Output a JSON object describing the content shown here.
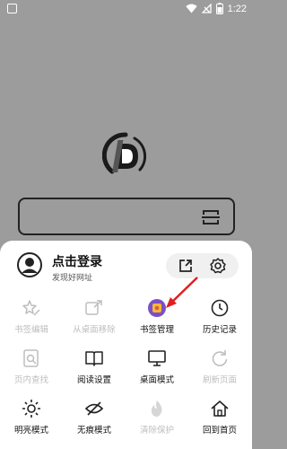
{
  "status": {
    "time": "1:22"
  },
  "profile": {
    "login_label": "点击登录",
    "tagline": "发现好网址"
  },
  "menu": [
    {
      "label": "书签编辑",
      "icon": "star-pen-icon",
      "enabled": false
    },
    {
      "label": "从桌面移除",
      "icon": "remove-from-desktop-icon",
      "enabled": false
    },
    {
      "label": "书签管理",
      "icon": "bookmark-manage-icon",
      "enabled": true
    },
    {
      "label": "历史记录",
      "icon": "clock-icon",
      "enabled": true
    },
    {
      "label": "页内查找",
      "icon": "find-in-page-icon",
      "enabled": false
    },
    {
      "label": "阅读设置",
      "icon": "book-icon",
      "enabled": true
    },
    {
      "label": "桌面模式",
      "icon": "monitor-icon",
      "enabled": true
    },
    {
      "label": "刷新页面",
      "icon": "refresh-icon",
      "enabled": false
    },
    {
      "label": "明亮模式",
      "icon": "sun-icon",
      "enabled": true
    },
    {
      "label": "无痕模式",
      "icon": "eye-off-icon",
      "enabled": true
    },
    {
      "label": "清除保护",
      "icon": "flame-icon",
      "enabled": false
    },
    {
      "label": "回到首页",
      "icon": "home-icon",
      "enabled": true
    }
  ],
  "colors": {
    "overlay": "#9c9c9c",
    "disabled": "#bdbdbd",
    "annotation_arrow": "#e0201d",
    "bookmark_icon": "#7b4fc9"
  }
}
